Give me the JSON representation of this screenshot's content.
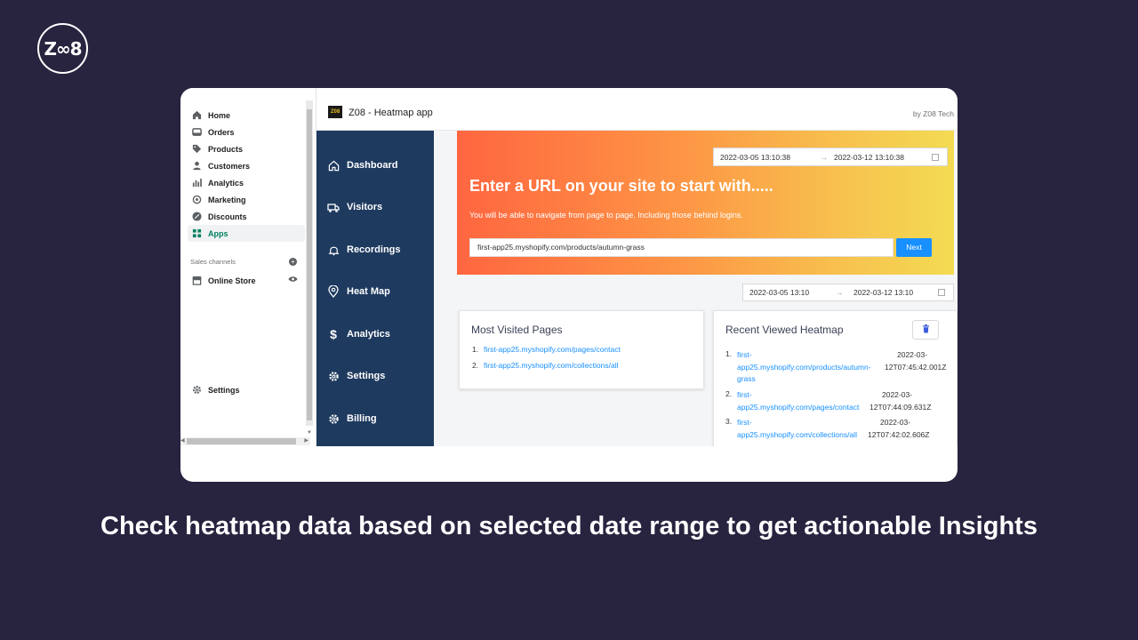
{
  "brand": {
    "logo_text": "Z∞8"
  },
  "admin_sidebar": {
    "items": [
      {
        "label": "Home",
        "icon": "home-icon"
      },
      {
        "label": "Orders",
        "icon": "orders-icon"
      },
      {
        "label": "Products",
        "icon": "tag-icon"
      },
      {
        "label": "Customers",
        "icon": "person-icon"
      },
      {
        "label": "Analytics",
        "icon": "bar-chart-icon"
      },
      {
        "label": "Marketing",
        "icon": "target-icon"
      },
      {
        "label": "Discounts",
        "icon": "discount-icon"
      },
      {
        "label": "Apps",
        "icon": "apps-icon",
        "active": true
      }
    ],
    "sales_channels_label": "Sales channels",
    "online_store_label": "Online Store",
    "settings_label": "Settings"
  },
  "app_header": {
    "logo_text": "Z08",
    "title": "Z08 - Heatmap app",
    "by": "by Z08 Tech"
  },
  "app_nav": [
    {
      "label": "Dashboard",
      "icon": "home-icon"
    },
    {
      "label": "Visitors",
      "icon": "truck-icon"
    },
    {
      "label": "Recordings",
      "icon": "bell-icon"
    },
    {
      "label": "Heat Map",
      "icon": "location-pin-icon"
    },
    {
      "label": "Analytics",
      "icon": "dollar-icon"
    },
    {
      "label": "Settings",
      "icon": "gear-icon"
    },
    {
      "label": "Billing",
      "icon": "gear-icon"
    }
  ],
  "hero": {
    "date_start": "2022-03-05 13:10:38",
    "date_end": "2022-03-12 13:10:38",
    "date_separator": "→",
    "title": "Enter a URL on your site to start with.....",
    "subtitle": "You will be able to navigate from page to page. Including those behind logins.",
    "url_value": "first-app25.myshopify.com/products/autumn-grass",
    "next_label": "Next"
  },
  "date_range": {
    "start": "2022-03-05 13:10",
    "end": "2022-03-12 13:10",
    "separator": "→"
  },
  "most_visited": {
    "title": "Most Visited Pages",
    "items": [
      {
        "num": "1.",
        "url": "first-app25.myshopify.com/pages/contact"
      },
      {
        "num": "2.",
        "url": "first-app25.myshopify.com/collections/all"
      }
    ]
  },
  "recent_heatmap": {
    "title": "Recent Viewed Heatmap",
    "items": [
      {
        "num": "1.",
        "url_l1": "first-",
        "url_l2": "app25.myshopify.com/products/autumn-",
        "url_l3": "grass",
        "time_l1": "2022-03-",
        "time_l2": "12T07:45:42.001Z"
      },
      {
        "num": "2.",
        "url_l1": "first-",
        "url_l2": "app25.myshopify.com/pages/contact",
        "time_l1": "2022-03-",
        "time_l2": "12T07:44:09.631Z"
      },
      {
        "num": "3.",
        "url_l1": "first-",
        "url_l2": "app25.myshopify.com/collections/all",
        "time_l1": "2022-03-",
        "time_l2": "12T07:42:02.606Z"
      }
    ]
  },
  "caption": "Check heatmap data based on selected date range to get actionable Insights",
  "colors": {
    "background": "#28233f",
    "app_sidebar": "#1e3a5f",
    "accent_blue": "#1890ff",
    "active_green": "#007f5f"
  }
}
